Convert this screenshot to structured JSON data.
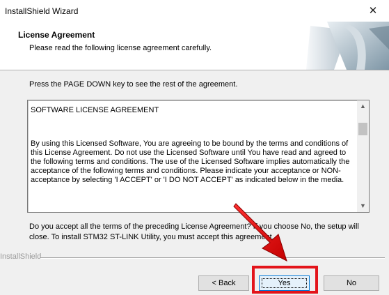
{
  "window": {
    "title": "InstallShield Wizard",
    "close_glyph": "✕"
  },
  "header": {
    "title": "License Agreement",
    "subtitle": "Please read the following license agreement carefully."
  },
  "instruction": "Press the PAGE DOWN key to see the rest of the agreement.",
  "license": {
    "heading": "SOFTWARE LICENSE AGREEMENT",
    "body": "By using this Licensed Software, You are agreeing to be bound by the terms and conditions of this License Agreement. Do not use the Licensed Software until You have read and agreed to the following terms and conditions. The use of the Licensed Software implies automatically the acceptance of the following terms and conditions. Please indicate your acceptance or NON-acceptance by selecting 'I ACCEPT' or 'I DO NOT ACCEPT' as indicated below in the media.",
    "scroll_up_glyph": "▲",
    "scroll_down_glyph": "▼"
  },
  "question": "Do you accept all the terms of the preceding License Agreement? If you choose No, the setup will close. To install STM32 ST-LINK Utility, you must accept this agreement.",
  "branding": "InstallShield",
  "buttons": {
    "back": "< Back",
    "yes": "Yes",
    "no": "No"
  },
  "colors": {
    "annotation_red": "#e3141a",
    "focus_blue": "#0078d7"
  }
}
